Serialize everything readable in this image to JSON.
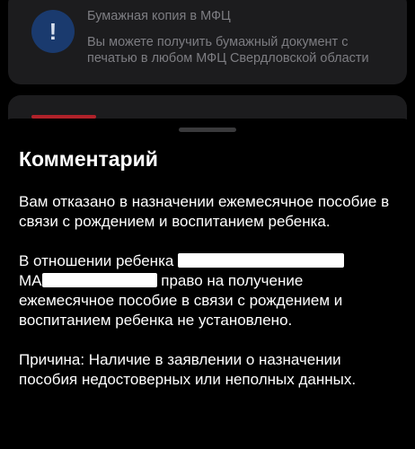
{
  "background_card": {
    "icon": "exclamation-icon",
    "title": "Бумажная копия в МФЦ",
    "text": "Вы можете получить бумажный документ с печатью в любом МФЦ Свердловской области"
  },
  "sheet": {
    "title": "Комментарий",
    "paragraph1": "Вам отказано в назначении ежемесячное пособие в связи с рождением и воспитанием ребенка.",
    "paragraph2_start": "В отношении ребенка",
    "paragraph2_line2_start": "МА",
    "paragraph2_line2_end": "право на получение",
    "paragraph2_end": "ежемесячное пособие в связи с рождением и воспитанием ребенка не установлено.",
    "paragraph3": "Причина: Наличие в заявлении о назначении пособия недостоверных или неполных данных."
  },
  "colors": {
    "background": "#000000",
    "card": "#1c1c1e",
    "icon_bg": "#1a3a6e",
    "accent_red": "#b0222a",
    "text_primary": "#ffffff",
    "text_dimmed": "#7d7d82"
  }
}
